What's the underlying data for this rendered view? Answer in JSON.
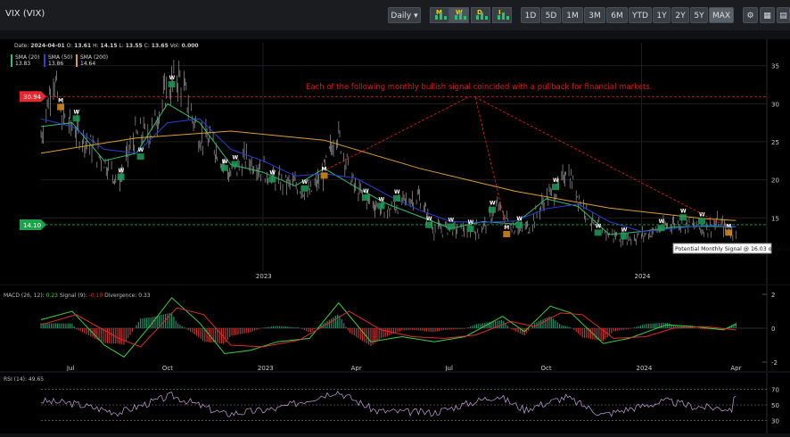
{
  "header": {
    "symbol": "VIX (VIX)",
    "interval_label": "Daily",
    "chart_type_buttons": [
      "M",
      "W",
      "D",
      "I"
    ],
    "ranges": [
      "1D",
      "5D",
      "1M",
      "3M",
      "6M",
      "YTD",
      "1Y",
      "2Y",
      "5Y",
      "MAX"
    ],
    "active_range": "MAX",
    "tool_icons": [
      "settings-icon",
      "calculator-icon",
      "calendar-icon"
    ]
  },
  "ohlc": {
    "date_label": "Date:",
    "date": "2024-04-01",
    "open_label": "O:",
    "open": "13.61",
    "high_label": "H:",
    "high": "14.15",
    "low_label": "L:",
    "low": "13.55",
    "close_label": "C:",
    "close": "13.65",
    "vol_label": "Vol:",
    "vol": "0.000"
  },
  "legend": [
    {
      "name": "SMA (20)",
      "value": "13.83",
      "color": "#2fbf71"
    },
    {
      "name": "SMA (50)",
      "value": "13.86",
      "color": "#2a3fd6"
    },
    {
      "name": "SMA (200)",
      "value": "14.64",
      "color": "#e0a020"
    }
  ],
  "annotation": {
    "text": "Each of the following monthly bullish signal coincided with a pullback for financial markets.",
    "color": "#e01818"
  },
  "tooltip": "Potential Monthly Signal @ 16.03 on 4/1/20",
  "price_flags": [
    {
      "label": "30.94",
      "value": 30.94,
      "color": "#e8262e"
    },
    {
      "label": "14.10",
      "value": 14.1,
      "color": "#1ea34a"
    }
  ],
  "y_ticks": [
    "35",
    "30",
    "25",
    "20",
    "15"
  ],
  "x_ticks": [
    "2023",
    "2024"
  ],
  "bottom_ticks": [
    "Jul",
    "Oct",
    "2023",
    "Apr",
    "Jul",
    "Oct",
    "2024",
    "Apr"
  ],
  "macd": {
    "label": "MACD (26, 12):",
    "macd": "0.23",
    "signal_label": "Signal (9):",
    "signal": "-0.10",
    "div_label": "Divergence:",
    "divergence": "0.33",
    "ticks": [
      "2",
      "0",
      "-2"
    ]
  },
  "rsi": {
    "label": "RSI (14):",
    "value": "49.65",
    "ticks": [
      "70",
      "50",
      "30"
    ]
  },
  "chart_data": {
    "type": "line",
    "title": "VIX (VIX)",
    "y_range": [
      8,
      38
    ],
    "x_range": [
      "2022-06-01",
      "2024-04-05"
    ],
    "series": [
      {
        "name": "VIX",
        "points": [
          [
            "2022-06-01",
            25.7
          ],
          [
            "2022-06-13",
            34.0
          ],
          [
            "2022-06-20",
            28.5
          ],
          [
            "2022-07-01",
            27.0
          ],
          [
            "2022-07-15",
            25.0
          ],
          [
            "2022-08-01",
            22.5
          ],
          [
            "2022-08-15",
            19.8
          ],
          [
            "2022-08-31",
            25.8
          ],
          [
            "2022-09-15",
            26.3
          ],
          [
            "2022-09-30",
            31.6
          ],
          [
            "2022-10-12",
            33.6
          ],
          [
            "2022-10-31",
            25.9
          ],
          [
            "2022-11-15",
            24.5
          ],
          [
            "2022-11-30",
            20.6
          ],
          [
            "2022-12-15",
            22.8
          ],
          [
            "2022-12-30",
            21.7
          ],
          [
            "2023-01-15",
            19.8
          ],
          [
            "2023-01-31",
            19.4
          ],
          [
            "2023-02-15",
            18.2
          ],
          [
            "2023-02-28",
            20.7
          ],
          [
            "2023-03-13",
            26.5
          ],
          [
            "2023-03-31",
            18.7
          ],
          [
            "2023-04-15",
            17.1
          ],
          [
            "2023-04-30",
            15.8
          ],
          [
            "2023-05-15",
            17.0
          ],
          [
            "2023-05-31",
            17.9
          ],
          [
            "2023-06-15",
            13.5
          ],
          [
            "2023-06-30",
            13.6
          ],
          [
            "2023-07-15",
            13.3
          ],
          [
            "2023-07-31",
            13.6
          ],
          [
            "2023-08-15",
            16.5
          ],
          [
            "2023-08-31",
            13.6
          ],
          [
            "2023-09-15",
            13.8
          ],
          [
            "2023-09-30",
            17.5
          ],
          [
            "2023-10-15",
            19.0
          ],
          [
            "2023-10-20",
            21.7
          ],
          [
            "2023-10-31",
            18.1
          ],
          [
            "2023-11-15",
            14.2
          ],
          [
            "2023-11-30",
            12.9
          ],
          [
            "2023-12-15",
            12.3
          ],
          [
            "2023-12-29",
            12.5
          ],
          [
            "2024-01-15",
            13.3
          ],
          [
            "2024-01-31",
            14.4
          ],
          [
            "2024-02-15",
            14.2
          ],
          [
            "2024-02-29",
            13.4
          ],
          [
            "2024-03-15",
            14.4
          ],
          [
            "2024-03-28",
            13.0
          ],
          [
            "2024-04-01",
            13.65
          ]
        ]
      },
      {
        "name": "SMA (20)",
        "points": [
          [
            "2022-06-01",
            27
          ],
          [
            "2022-07-01",
            27.5
          ],
          [
            "2022-08-01",
            22.5
          ],
          [
            "2022-09-01",
            23.5
          ],
          [
            "2022-10-01",
            30
          ],
          [
            "2022-11-01",
            27.5
          ],
          [
            "2022-12-01",
            22
          ],
          [
            "2023-01-01",
            21
          ],
          [
            "2023-02-01",
            19.2
          ],
          [
            "2023-03-01",
            21.5
          ],
          [
            "2023-04-01",
            19
          ],
          [
            "2023-05-01",
            16.8
          ],
          [
            "2023-06-01",
            15.2
          ],
          [
            "2023-07-01",
            13.6
          ],
          [
            "2023-08-01",
            14.5
          ],
          [
            "2023-09-01",
            14.2
          ],
          [
            "2023-10-01",
            17.5
          ],
          [
            "2023-11-01",
            16.5
          ],
          [
            "2023-12-01",
            12.8
          ],
          [
            "2024-01-01",
            13.2
          ],
          [
            "2024-02-01",
            13.8
          ],
          [
            "2024-03-01",
            13.9
          ],
          [
            "2024-04-01",
            13.83
          ]
        ]
      },
      {
        "name": "SMA (50)",
        "points": [
          [
            "2022-06-01",
            28
          ],
          [
            "2022-07-01",
            27
          ],
          [
            "2022-08-01",
            24
          ],
          [
            "2022-09-01",
            23.5
          ],
          [
            "2022-10-01",
            27.5
          ],
          [
            "2022-11-01",
            28
          ],
          [
            "2022-12-01",
            24
          ],
          [
            "2023-01-01",
            22.5
          ],
          [
            "2023-02-01",
            20.5
          ],
          [
            "2023-03-01",
            20.8
          ],
          [
            "2023-04-01",
            20.2
          ],
          [
            "2023-05-01",
            18
          ],
          [
            "2023-06-01",
            16
          ],
          [
            "2023-07-01",
            14.5
          ],
          [
            "2023-08-01",
            14.4
          ],
          [
            "2023-09-01",
            14.6
          ],
          [
            "2023-10-01",
            16.2
          ],
          [
            "2023-11-01",
            16.8
          ],
          [
            "2023-12-01",
            14.5
          ],
          [
            "2024-01-01",
            13.2
          ],
          [
            "2024-02-01",
            13.6
          ],
          [
            "2024-03-01",
            14
          ],
          [
            "2024-04-01",
            13.86
          ]
        ]
      },
      {
        "name": "SMA (200)",
        "points": [
          [
            "2022-06-01",
            23.5
          ],
          [
            "2022-09-01",
            25.5
          ],
          [
            "2022-12-01",
            26.4
          ],
          [
            "2023-03-01",
            25.2
          ],
          [
            "2023-06-01",
            21.5
          ],
          [
            "2023-09-01",
            18.5
          ],
          [
            "2023-12-01",
            16.3
          ],
          [
            "2024-03-01",
            14.9
          ],
          [
            "2024-04-01",
            14.64
          ]
        ]
      }
    ],
    "signals": [
      {
        "date": "2022-06-20",
        "type": "M",
        "value": 29.5
      },
      {
        "date": "2022-07-05",
        "type": "W",
        "value": 28
      },
      {
        "date": "2022-08-17",
        "type": "W",
        "value": 20.3
      },
      {
        "date": "2022-09-05",
        "type": "W",
        "value": 23
      },
      {
        "date": "2022-10-05",
        "type": "W",
        "value": 32.5
      },
      {
        "date": "2022-11-25",
        "type": "W",
        "value": 21.5
      },
      {
        "date": "2022-12-05",
        "type": "W",
        "value": 22
      },
      {
        "date": "2023-01-10",
        "type": "W",
        "value": 20
      },
      {
        "date": "2023-02-10",
        "type": "W",
        "value": 18.8
      },
      {
        "date": "2023-03-01",
        "type": "M",
        "value": 20.5
      },
      {
        "date": "2023-04-10",
        "type": "W",
        "value": 17.6
      },
      {
        "date": "2023-04-25",
        "type": "W",
        "value": 16.5
      },
      {
        "date": "2023-05-10",
        "type": "W",
        "value": 17.5
      },
      {
        "date": "2023-06-10",
        "type": "W",
        "value": 14
      },
      {
        "date": "2023-07-01",
        "type": "W",
        "value": 13.8
      },
      {
        "date": "2023-07-20",
        "type": "W",
        "value": 13.5
      },
      {
        "date": "2023-08-10",
        "type": "W",
        "value": 16
      },
      {
        "date": "2023-08-24",
        "type": "M",
        "value": 12.8
      },
      {
        "date": "2023-09-05",
        "type": "W",
        "value": 14
      },
      {
        "date": "2023-10-10",
        "type": "W",
        "value": 19
      },
      {
        "date": "2023-11-20",
        "type": "W",
        "value": 13
      },
      {
        "date": "2023-12-15",
        "type": "W",
        "value": 12.5
      },
      {
        "date": "2024-01-20",
        "type": "W",
        "value": 13.6
      },
      {
        "date": "2024-02-10",
        "type": "W",
        "value": 15
      },
      {
        "date": "2024-02-28",
        "type": "W",
        "value": 14.5
      },
      {
        "date": "2024-03-25",
        "type": "M",
        "value": 13
      }
    ],
    "macd": {
      "macd_line": [
        [
          "2022-06-01",
          0.5
        ],
        [
          "2022-07-01",
          1.0
        ],
        [
          "2022-08-01",
          -1.0
        ],
        [
          "2022-08-20",
          -1.7
        ],
        [
          "2022-09-15",
          0.2
        ],
        [
          "2022-10-05",
          1.8
        ],
        [
          "2022-11-01",
          0.3
        ],
        [
          "2022-11-25",
          -1.5
        ],
        [
          "2022-12-20",
          -1.3
        ],
        [
          "2023-01-15",
          -0.8
        ],
        [
          "2023-02-15",
          -0.6
        ],
        [
          "2023-03-15",
          1.5
        ],
        [
          "2023-04-15",
          -0.8
        ],
        [
          "2023-05-15",
          -0.5
        ],
        [
          "2023-06-15",
          -0.8
        ],
        [
          "2023-07-15",
          -0.5
        ],
        [
          "2023-08-20",
          0.7
        ],
        [
          "2023-09-10",
          -0.2
        ],
        [
          "2023-10-05",
          1.3
        ],
        [
          "2023-10-25",
          0.9
        ],
        [
          "2023-11-25",
          -0.9
        ],
        [
          "2023-12-20",
          -0.6
        ],
        [
          "2024-01-25",
          0.2
        ],
        [
          "2024-02-20",
          0.1
        ],
        [
          "2024-03-20",
          -0.1
        ],
        [
          "2024-04-01",
          0.23
        ]
      ],
      "signal_line": [
        [
          "2022-06-01",
          0.2
        ],
        [
          "2022-07-05",
          0.8
        ],
        [
          "2022-08-15",
          -0.6
        ],
        [
          "2022-09-05",
          -1.1
        ],
        [
          "2022-10-10",
          1.2
        ],
        [
          "2022-11-05",
          0.8
        ],
        [
          "2022-12-01",
          -1.0
        ],
        [
          "2023-01-01",
          -1.1
        ],
        [
          "2023-02-05",
          -0.7
        ],
        [
          "2023-03-25",
          1.0
        ],
        [
          "2023-04-25",
          -0.1
        ],
        [
          "2023-05-25",
          -0.5
        ],
        [
          "2023-06-25",
          -0.6
        ],
        [
          "2023-07-25",
          -0.4
        ],
        [
          "2023-08-28",
          0.4
        ],
        [
          "2023-09-20",
          0.1
        ],
        [
          "2023-10-15",
          0.9
        ],
        [
          "2023-11-05",
          0.8
        ],
        [
          "2023-12-05",
          -0.6
        ],
        [
          "2024-01-05",
          -0.5
        ],
        [
          "2024-02-01",
          0.0
        ],
        [
          "2024-03-01",
          0.1
        ],
        [
          "2024-04-01",
          -0.1
        ]
      ]
    },
    "rsi": {
      "points": [
        [
          "2022-06-01",
          55
        ],
        [
          "2022-07-01",
          52
        ],
        [
          "2022-08-15",
          40
        ],
        [
          "2022-10-05",
          62
        ],
        [
          "2022-11-25",
          38
        ],
        [
          "2023-01-15",
          45
        ],
        [
          "2023-03-13",
          68
        ],
        [
          "2023-04-20",
          42
        ],
        [
          "2023-06-15",
          40
        ],
        [
          "2023-08-15",
          62
        ],
        [
          "2023-09-10",
          44
        ],
        [
          "2023-10-20",
          60
        ],
        [
          "2023-11-25",
          37
        ],
        [
          "2023-12-20",
          45
        ],
        [
          "2024-01-25",
          55
        ],
        [
          "2024-02-20",
          48
        ],
        [
          "2024-03-28",
          45
        ],
        [
          "2024-04-01",
          65
        ]
      ]
    }
  }
}
